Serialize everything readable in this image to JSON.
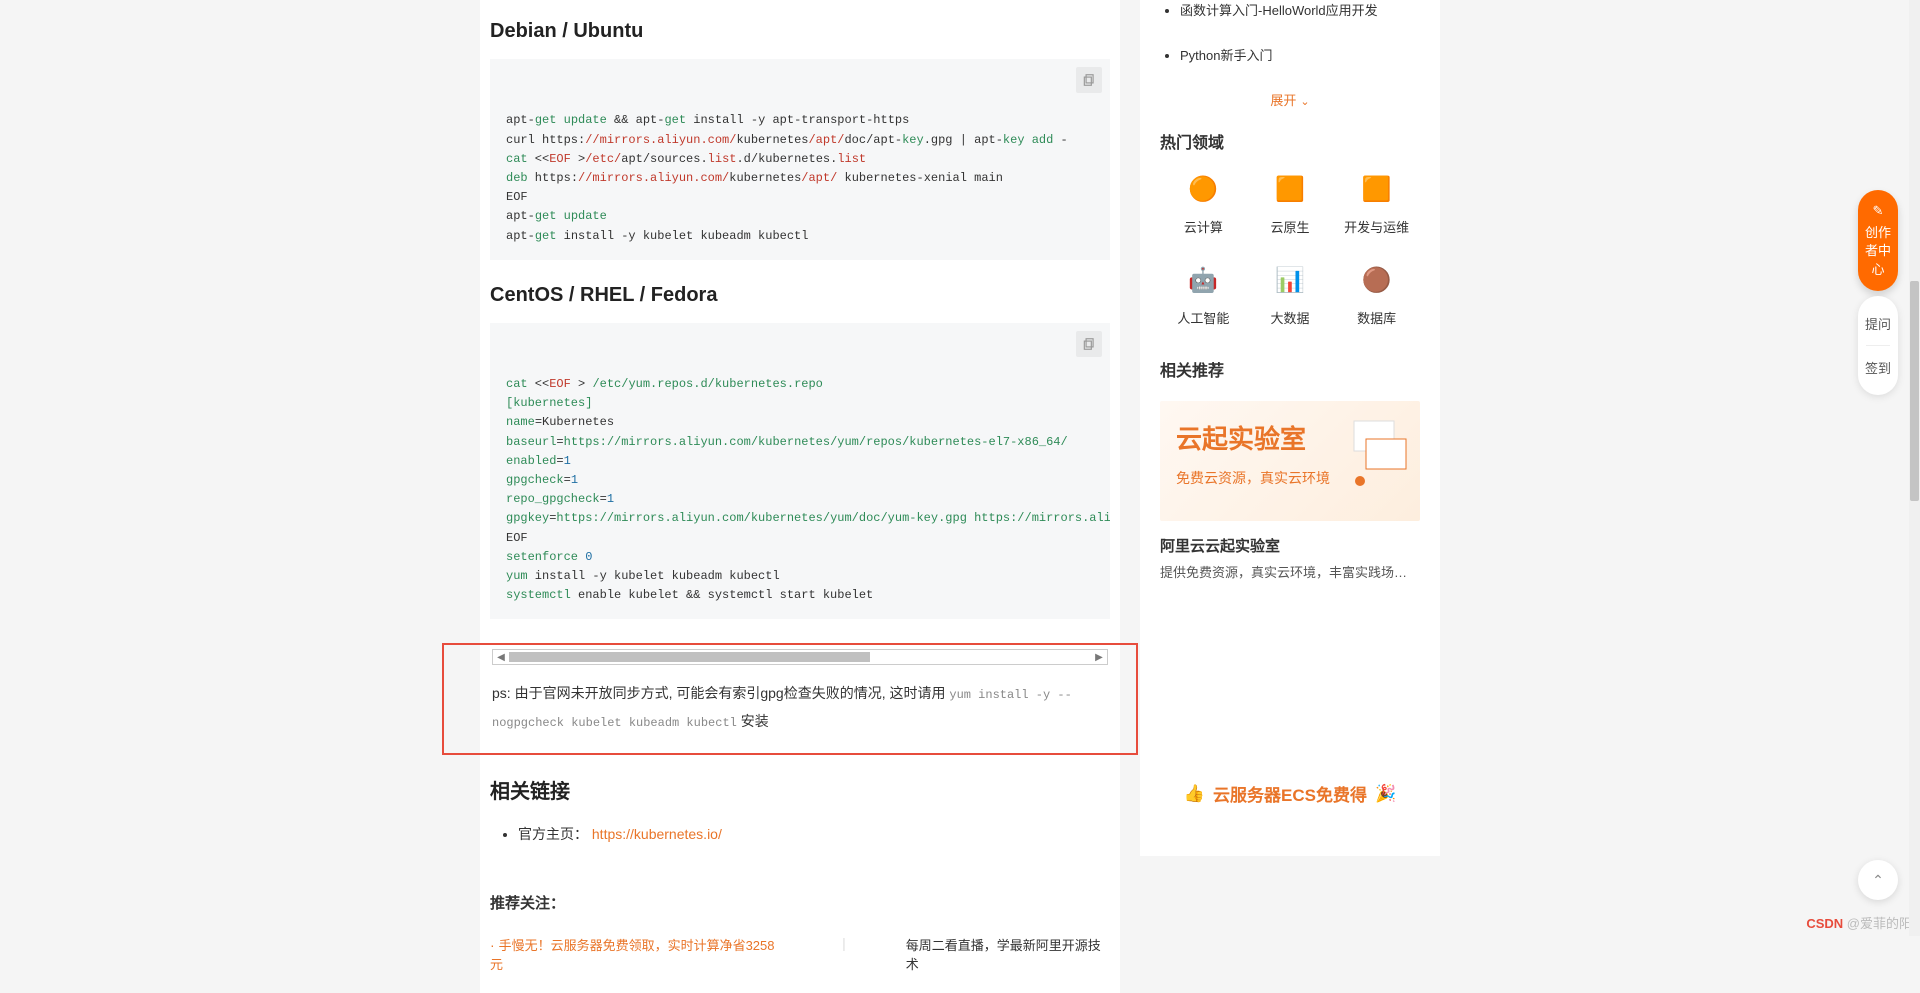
{
  "article": {
    "section1_title": "Debian / Ubuntu",
    "code1": {
      "l1": "apt-get update && apt-get install -y apt-transport-https",
      "l2": "curl https://mirrors.aliyun.com/kubernetes/apt/doc/apt-key.gpg | apt-key add -",
      "l3": "cat <<EOF >/etc/apt/sources.list.d/kubernetes.list",
      "l4": "deb https://mirrors.aliyun.com/kubernetes/apt/ kubernetes-xenial main",
      "l5": "EOF",
      "l6": "apt-get update",
      "l7": "apt-get install -y kubelet kubeadm kubectl"
    },
    "section2_title": "CentOS / RHEL / Fedora",
    "code2": {
      "l1": "cat <<EOF > /etc/yum.repos.d/kubernetes.repo",
      "l2": "[kubernetes]",
      "l3": "name=Kubernetes",
      "l4": "baseurl=https://mirrors.aliyun.com/kubernetes/yum/repos/kubernetes-el7-x86_64/",
      "l5": "enabled=1",
      "l6": "gpgcheck=1",
      "l7": "repo_gpgcheck=1",
      "l8": "gpgkey=https://mirrors.aliyun.com/kubernetes/yum/doc/yum-key.gpg https://mirrors.aliyun.com/",
      "l9": "EOF",
      "l10": "setenforce 0",
      "l11": "yum install -y kubelet kubeadm kubectl",
      "l12": "systemctl enable kubelet && systemctl start kubelet"
    },
    "ps_prefix": "ps: 由于官网未开放同步方式, 可能会有索引gpg检查失败的情况, 这时请用 ",
    "ps_code": "yum install -y --nogpgcheck kubelet kubeadm kubectl",
    "ps_suffix": " 安装",
    "links_title": "相关链接",
    "links_official_label": "官方主页：",
    "links_official_url": "https://kubernetes.io/",
    "rec_title": "推荐关注：",
    "rec1_prefix": "·",
    "rec1_text": "手慢无！云服务器免费领取，实时计算净省3258元",
    "rec_sep": "|",
    "rec2_text": "每周二看直播，学最新阿里开源技术"
  },
  "sidebar": {
    "items": [
      "函数计算入门-HelloWorld应用开发",
      "Python新手入门"
    ],
    "expand": "展开",
    "hot_title": "热门领域",
    "domains": [
      {
        "label": "云计算"
      },
      {
        "label": "云原生"
      },
      {
        "label": "开发与运维"
      },
      {
        "label": "人工智能"
      },
      {
        "label": "大数据"
      },
      {
        "label": "数据库"
      }
    ],
    "rec_title": "相关推荐",
    "banner_big": "云起实验室",
    "banner_small": "免费云资源，真实云环境",
    "rec_caption": "阿里云云起实验室",
    "rec_sub": "提供免费资源，真实云环境，丰富实践场景，..."
  },
  "bottom_banner": "云服务器ECS免费得",
  "fab": {
    "creator": "创作者中心",
    "ask": "提问",
    "signin": "签到"
  },
  "watermark": {
    "csdn": "CSDN",
    "rest": " @爱菲的阳"
  }
}
